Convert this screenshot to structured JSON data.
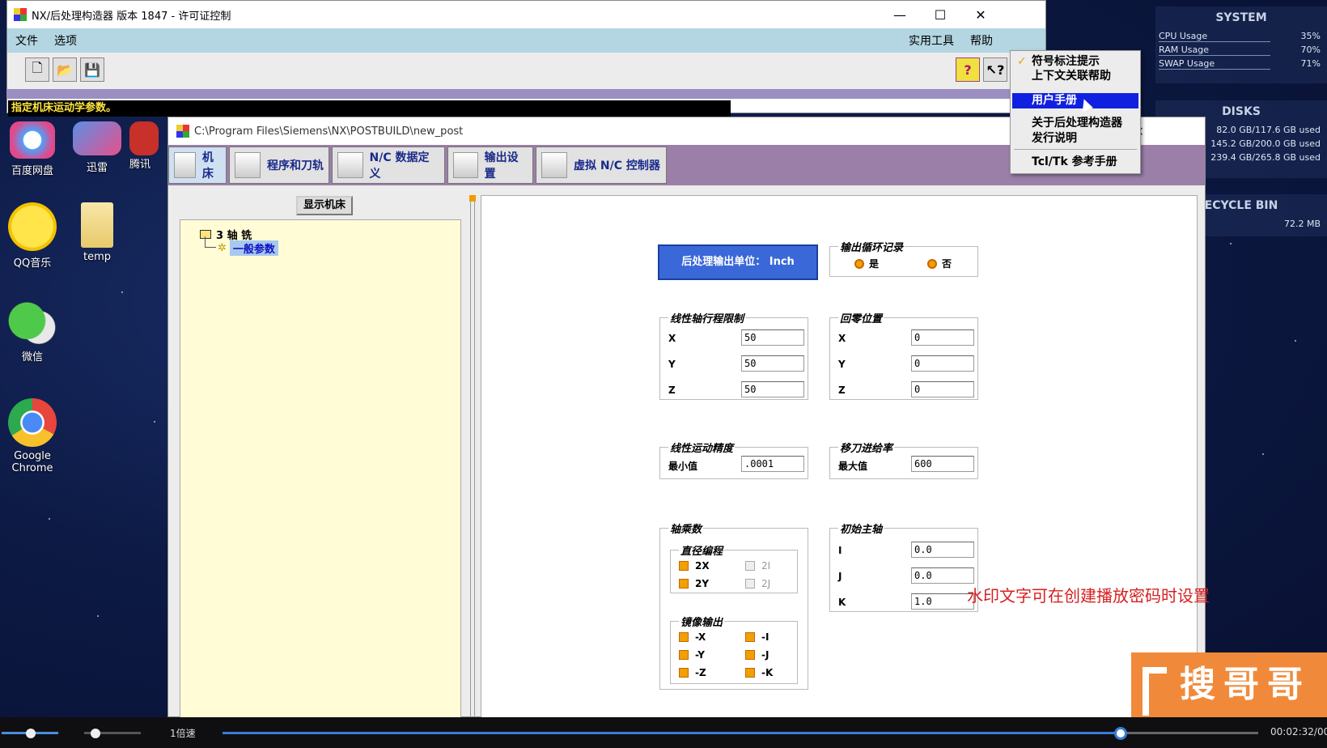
{
  "main_window": {
    "title": "NX/后处理构造器 版本 1847 - 许可证控制",
    "controls": {
      "minimize": "—",
      "maximize": "☐",
      "close": "✕"
    },
    "menu": [
      "文件",
      "选项"
    ],
    "menu_right": [
      "实用工具",
      "帮助"
    ],
    "toolbar_buttons": [
      "new-file-icon",
      "open-folder-icon",
      "save-icon"
    ],
    "help_buttons": [
      "help-bubble-icon",
      "context-help-icon"
    ],
    "hint": "指定机床运动学参数。"
  },
  "help_menu": {
    "items": [
      "符号标注提示",
      "上下文关联帮助",
      "用户手册",
      "关于后处理构造器",
      "发行说明",
      "Tcl/Tk 参考手册"
    ],
    "checked_item": "符号标注提示",
    "highlighted_item": "用户手册"
  },
  "sub_window": {
    "path": "C:\\Program Files\\Siemens\\NX\\POSTBUILD\\new_post",
    "close": "✕",
    "tabs": [
      "机床",
      "程序和刀轨",
      "N/C 数据定义",
      "输出设置",
      "虚拟 N/C 控制器"
    ],
    "active_tab": "机床",
    "show_machine_button": "显示机床",
    "tree": {
      "root": "3 轴 铣",
      "child": "一般参数"
    },
    "output_unit": "后处理输出单位：  Inch",
    "loop_record": {
      "title": "输出循环记录",
      "yes": "是",
      "no": "否"
    },
    "linear_limits": {
      "title": "线性轴行程限制",
      "rows": [
        {
          "label": "X",
          "value": "50"
        },
        {
          "label": "Y",
          "value": "50"
        },
        {
          "label": "Z",
          "value": "50"
        }
      ]
    },
    "home_position": {
      "title": "回零位置",
      "rows": [
        {
          "label": "X",
          "value": "0"
        },
        {
          "label": "Y",
          "value": "0"
        },
        {
          "label": "Z",
          "value": "0"
        }
      ]
    },
    "linear_resolution": {
      "title": "线性运动精度",
      "label": "最小值",
      "value": ".0001"
    },
    "traverse_feed": {
      "title": "移刀进给率",
      "label": "最大值",
      "value": "600"
    },
    "axis_multipliers": {
      "title": "轴乘数",
      "diameter": {
        "title": "直径编程",
        "items": [
          "2X",
          "2I",
          "2Y",
          "2J"
        ]
      },
      "mirror": {
        "title": "镜像输出",
        "items": [
          "-X",
          "-I",
          "-Y",
          "-J",
          "-Z",
          "-K"
        ]
      }
    },
    "initial_spindle": {
      "title": "初始主轴",
      "rows": [
        {
          "label": "I",
          "value": "0.0"
        },
        {
          "label": "J",
          "value": "0.0"
        },
        {
          "label": "K",
          "value": "1.0"
        }
      ]
    }
  },
  "desktop": {
    "icons": [
      "百度网盘",
      "迅雷",
      "腾讯",
      "QQ音乐",
      "temp",
      "微信",
      "Google Chrome"
    ]
  },
  "widget": {
    "system_title": "SYSTEM",
    "system": [
      {
        "label": "CPU Usage",
        "value": "35%"
      },
      {
        "label": "RAM Usage",
        "value": "70%"
      },
      {
        "label": "SWAP Usage",
        "value": "71%"
      }
    ],
    "disks_title": "DISKS",
    "disks": [
      "82.0 GB/117.6 GB used",
      "145.2 GB/200.0 GB used",
      "239.4 GB/265.8 GB used"
    ],
    "recycle_title": "ECYCLE BIN",
    "recycle_size": "72.2 MB"
  },
  "watermark": "水印文字可在创建播放密码时设置",
  "brand": "搜哥哥",
  "player": {
    "speed": "1倍速",
    "time": "00:02:32/00"
  },
  "colors": {
    "accent": "#3a68d8",
    "menubar": "#b3d6e2",
    "tabstrip": "#9b7fa8",
    "highlight": "#1020e0"
  }
}
